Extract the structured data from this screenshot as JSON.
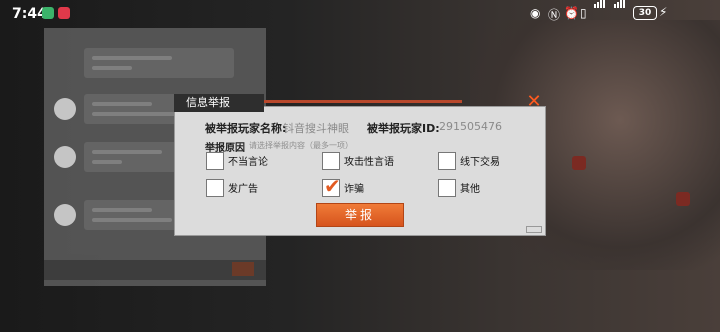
{
  "status_bar": {
    "time": "7:44",
    "battery": "30"
  },
  "dialog": {
    "title": "信息举报",
    "close_icon": "✕",
    "reported_name_label": "被举报玩家名称:",
    "reported_name_value": "钭音搜斗神眼",
    "reported_id_label": "被举报玩家ID:",
    "reported_id_value": "291505476",
    "reason_label": "举报原因",
    "reason_hint": "请选择举报内容（最多一项）",
    "options": [
      {
        "label": "不当言论",
        "checked": false
      },
      {
        "label": "攻击性言语",
        "checked": false
      },
      {
        "label": "线下交易",
        "checked": false
      },
      {
        "label": "发广告",
        "checked": false
      },
      {
        "label": "诈骗",
        "checked": true
      },
      {
        "label": "其他",
        "checked": false
      }
    ],
    "submit_label": "举报"
  },
  "colors": {
    "accent": "#e25a21",
    "dialog_bg": "#dcdcdc"
  }
}
